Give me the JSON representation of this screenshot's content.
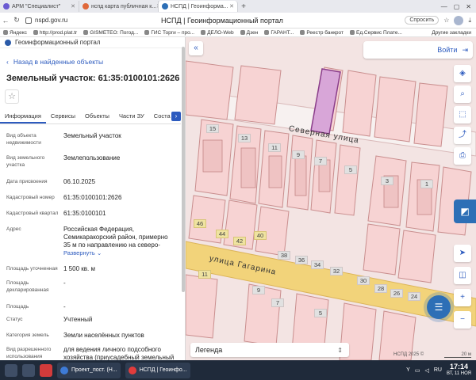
{
  "browser": {
    "tabs": [
      {
        "label": "АРМ \"Специалист\"",
        "color": "#6b5bd2",
        "active": false
      },
      {
        "label": "нспд карта публичная к...",
        "color": "#e0683a",
        "active": false
      },
      {
        "label": "НСПД | Геоинформа...",
        "color": "#2d6fb6",
        "active": true
      }
    ],
    "url": "nspd.gov.ru",
    "title": "НСПД | Геоинформационный портал",
    "ask_label": "Спросить",
    "bookmarks": [
      "Яндекс",
      "http://prod.plat.tr",
      "GISMETEO: Погод...",
      "ГИС Торги – про...",
      "ДЕЛО-Web",
      "Дзен",
      "ГАРАНТ...",
      "Реестр банкрот",
      "Ед.Сервис Плате..."
    ],
    "other_bookmarks": "Другие закладки"
  },
  "panel": {
    "portal_name": "Геоинформационный портал",
    "back_label": "Назад в найденные объекты",
    "object_title": "Земельный участок: 61:35:0100101:2626",
    "tabs": [
      "Информация",
      "Сервисы",
      "Объекты",
      "Части ЗУ",
      "Соста"
    ],
    "expand_label": "Развернуть",
    "rows": [
      {
        "key": "Вид объекта недвижимости",
        "value": "Земельный участок"
      },
      {
        "key": "Вид земельного участка",
        "value": "Землепользование"
      },
      {
        "key": "Дата присвоения",
        "value": "06.10.2025"
      },
      {
        "key": "Кадастровый номер",
        "value": "61:35:0100101:2626"
      },
      {
        "key": "Кадастровый квартал",
        "value": "61:35:0100101"
      },
      {
        "key": "Адрес",
        "value": "Российская Федерация, Семикаракорский район, примерно 35 м по направлению на северо-"
      },
      {
        "key": "Площадь уточненная",
        "value": "1 500 кв. м"
      },
      {
        "key": "Площадь декларированная",
        "value": "-"
      },
      {
        "key": "Площадь",
        "value": "-"
      },
      {
        "key": "Статус",
        "value": "Учтенный"
      },
      {
        "key": "Категория земель",
        "value": "Земли населённых пунктов"
      },
      {
        "key": "Вид разрешенного использования",
        "value": "для ведения личного подсобного хозяйства (приусадебный земельный"
      }
    ]
  },
  "map": {
    "login_label": "Войти",
    "legend_label": "Легенда",
    "streets": [
      "Северная улица",
      "улица Гагарина"
    ],
    "house_numbers": [
      "15",
      "13",
      "11",
      "9",
      "7",
      "5",
      "3",
      "1",
      "46",
      "44",
      "42",
      "40",
      "38",
      "36",
      "34",
      "32",
      "30",
      "28",
      "26",
      "24",
      "11",
      "9",
      "7",
      "5"
    ],
    "copyright": "НСПД 2025 ©",
    "scale_label": "20 м"
  },
  "taskbar": {
    "app_labels": [
      "Проект_пост. (Н...",
      "НСПД | Геоинфо..."
    ],
    "lang": "RU",
    "time": "17:14",
    "date": "ВТ, 11 НОЯ"
  }
}
